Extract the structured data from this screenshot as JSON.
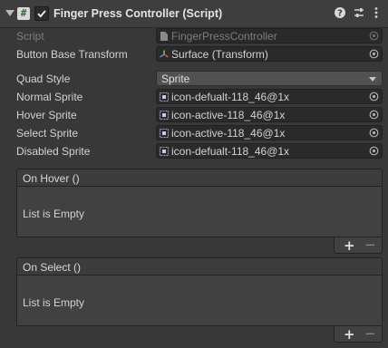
{
  "component": {
    "title": "Finger Press Controller (Script)",
    "enabled": true
  },
  "fields": {
    "script": {
      "label": "Script",
      "value": "FingerPressController"
    },
    "button_base_transform": {
      "label": "Button Base Transform",
      "value": "Surface (Transform)"
    },
    "quad_style": {
      "label": "Quad Style",
      "value": "Sprite"
    },
    "normal_sprite": {
      "label": "Normal Sprite",
      "value": "icon-defualt-118_46@1x"
    },
    "hover_sprite": {
      "label": "Hover Sprite",
      "value": "icon-active-118_46@1x"
    },
    "select_sprite": {
      "label": "Select Sprite",
      "value": "icon-active-118_46@1x"
    },
    "disabled_sprite": {
      "label": "Disabled Sprite",
      "value": "icon-defualt-118_46@1x"
    }
  },
  "events": {
    "on_hover": {
      "title": "On Hover ()",
      "empty_text": "List is Empty",
      "add": "+",
      "remove": "−"
    },
    "on_select": {
      "title": "On Select ()",
      "empty_text": "List is Empty",
      "add": "+",
      "remove": "−"
    }
  },
  "colors": {
    "background": "#383838",
    "header": "#3e3e3e",
    "field": "#2a2a2a",
    "text": "#d2d2d2",
    "disabled_text": "#7d7d7d"
  },
  "icons": [
    "foldout-arrow-icon",
    "script-icon",
    "checkbox-icon",
    "help-icon",
    "presets-icon",
    "menu-icon",
    "script-asset-icon",
    "transform-icon",
    "sprite-icon",
    "object-picker-icon"
  ]
}
